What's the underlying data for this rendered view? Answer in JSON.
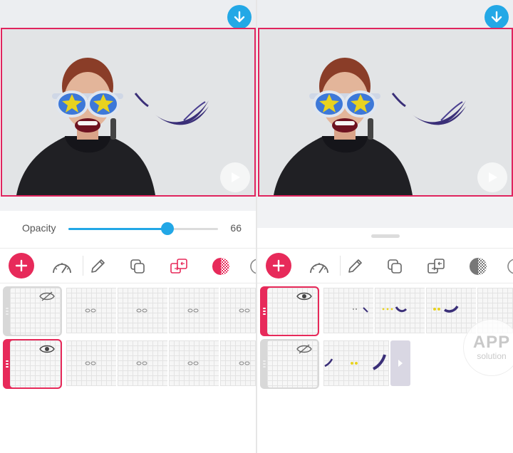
{
  "left_panel": {
    "opacity": {
      "label": "Opacity",
      "value": "66",
      "fraction": 0.66
    },
    "layers": [
      {
        "visible": false,
        "selected": false,
        "frames": 4
      },
      {
        "visible": true,
        "selected": true,
        "frames": 4
      }
    ]
  },
  "right_panel": {
    "layers": [
      {
        "visible": true,
        "selected": true,
        "frames": 4
      },
      {
        "visible": false,
        "selected": false,
        "frames": 2
      }
    ]
  },
  "toolbar": {
    "tools": [
      "add-icon",
      "speed-gauge-icon",
      "pencil-icon",
      "duplicate-icon",
      "layer-swap-icon",
      "opacity-icon",
      "more-icon"
    ]
  },
  "watermark": {
    "line1": "APP",
    "line2": "solution"
  },
  "colors": {
    "accent": "#e72a5a",
    "blue": "#22a7e6",
    "ink": "#3a2f78",
    "yellow": "#e8d21f"
  }
}
